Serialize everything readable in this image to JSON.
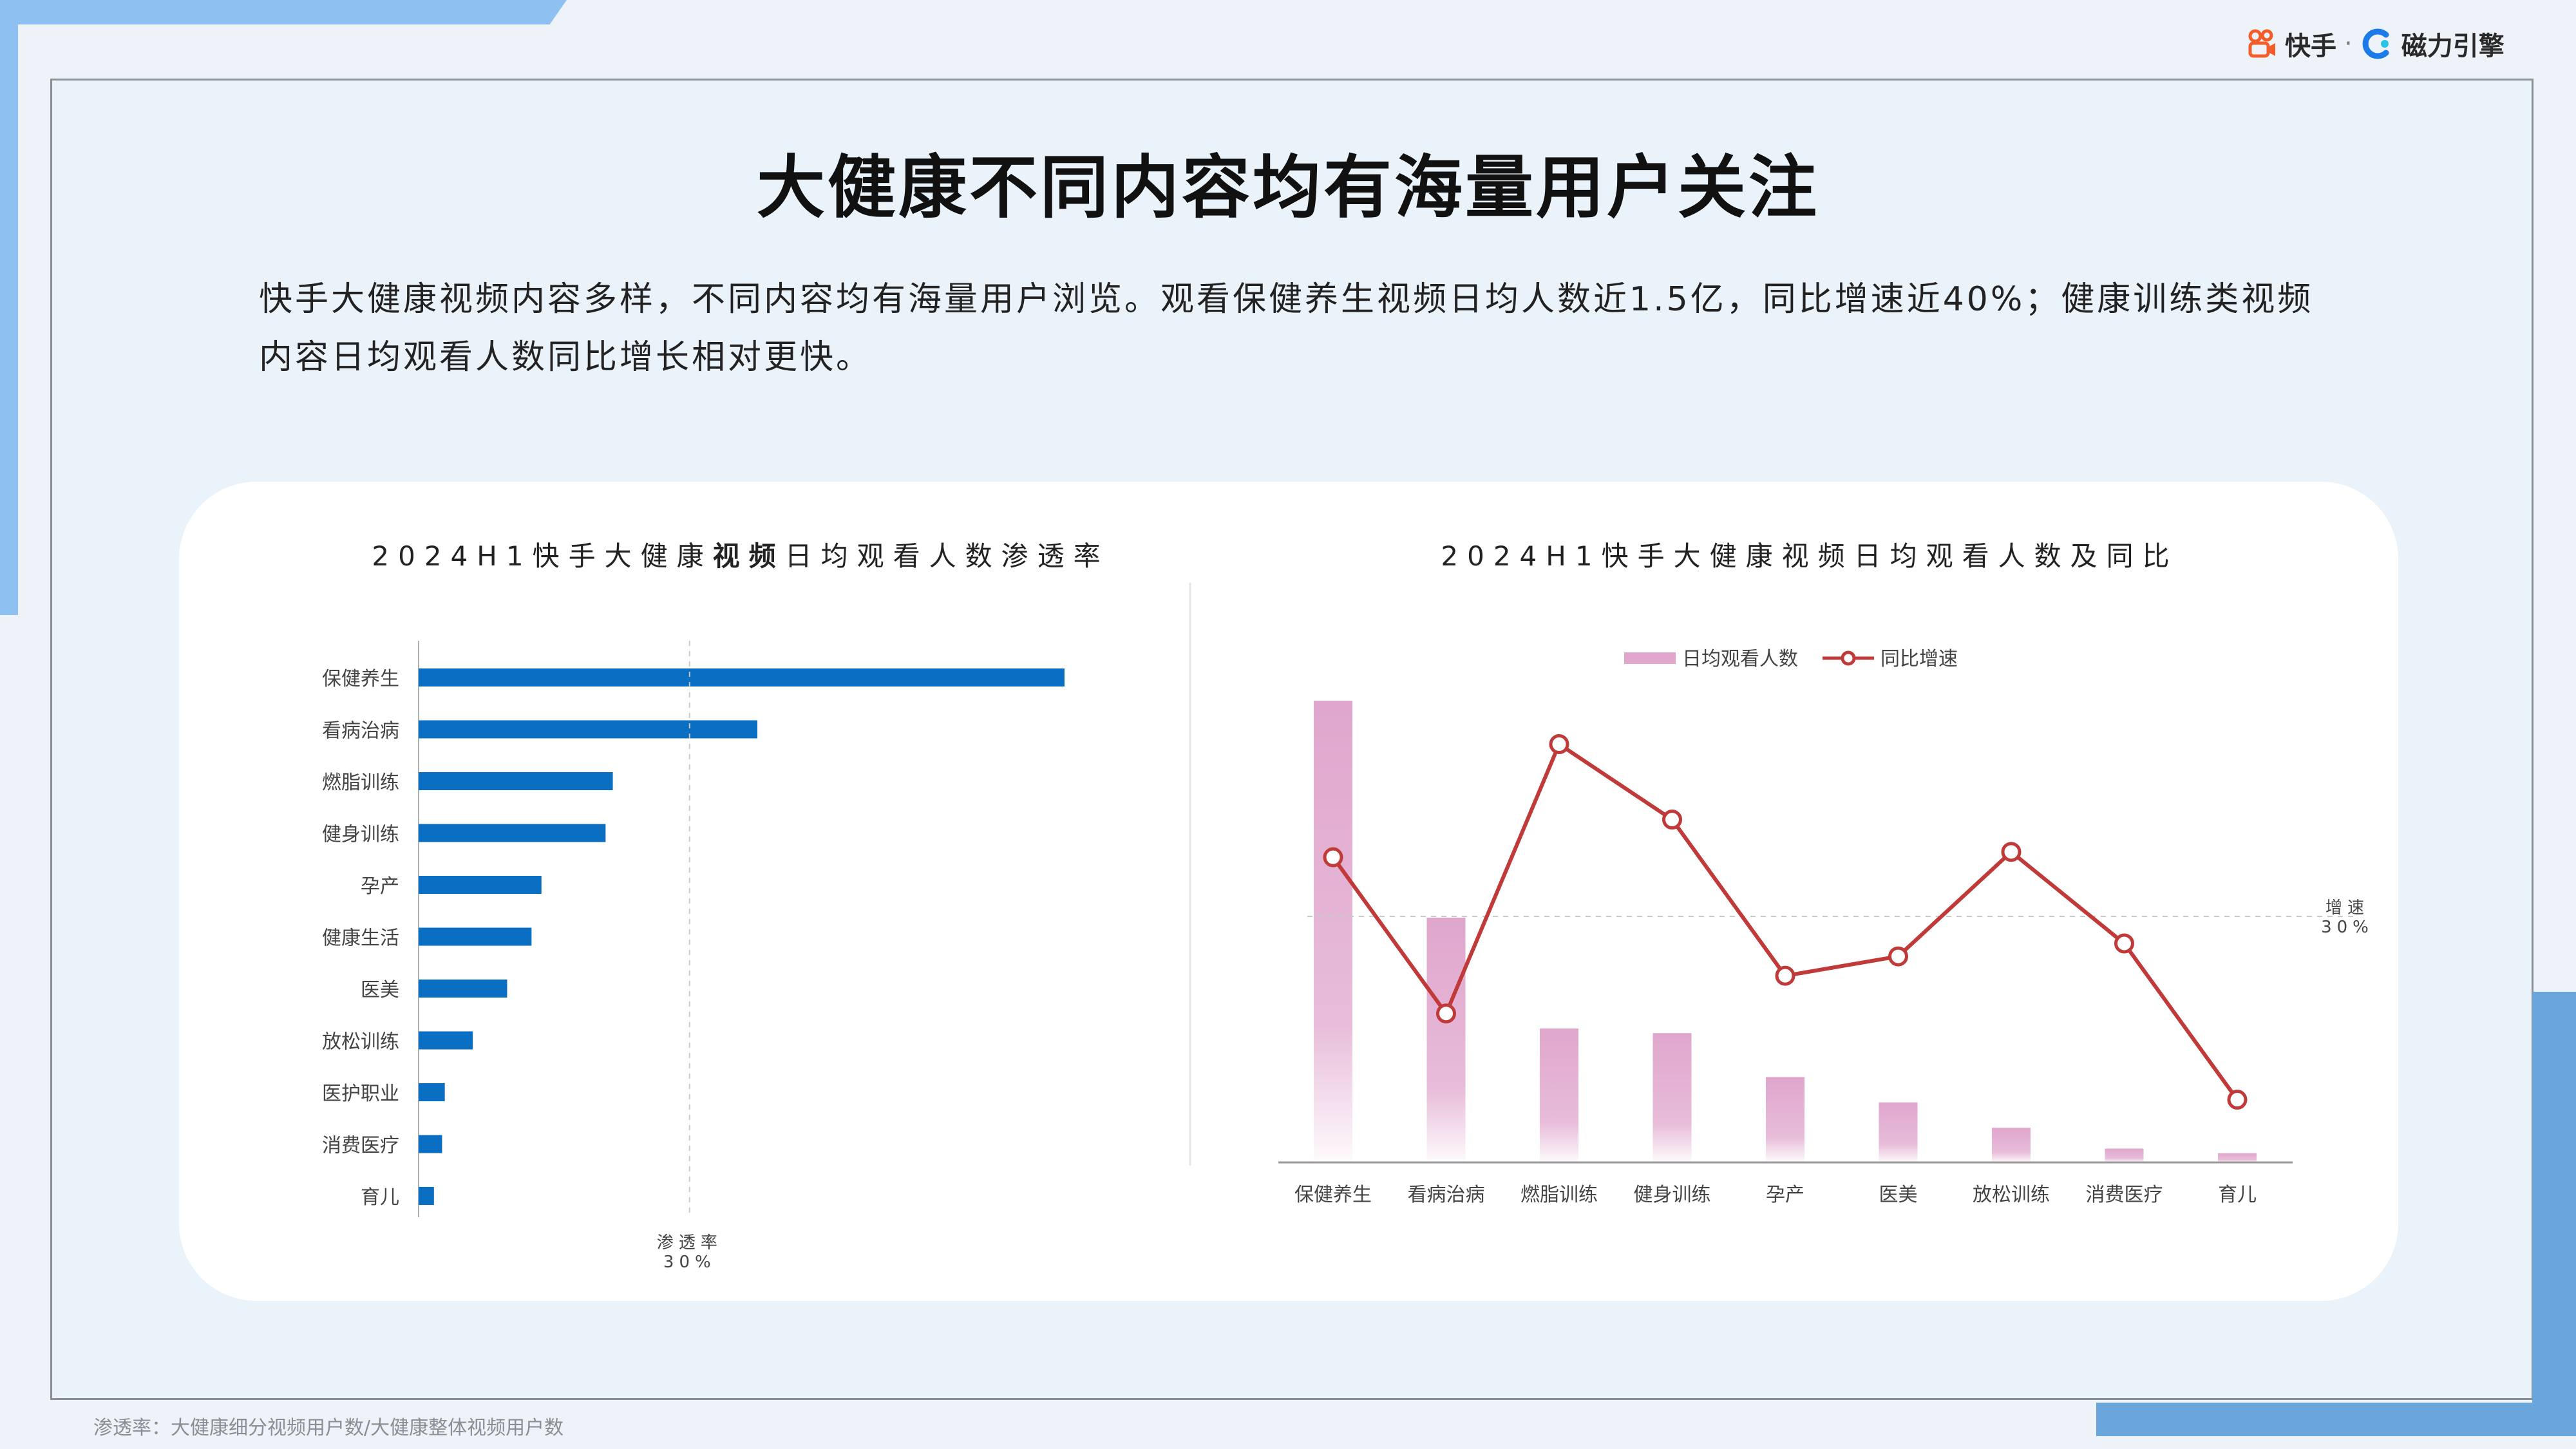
{
  "header": {
    "brand_kuaishou": "快手",
    "brand_separator": "·",
    "brand_cili": "磁力引擎",
    "title": "大健康不同内容均有海量用户关注",
    "description": "快手大健康视频内容多样，不同内容均有海量用户浏览。观看保健养生视频日均人数近1.5亿，同比增速近40%；健康训练类视频内容日均观看人数同比增长相对更快。"
  },
  "footnote": "渗透率：大健康细分视频用户数/大健康整体视频用户数",
  "colors": {
    "bar_blue": "#0a6ec2",
    "bar_pink": "#e0a6cd",
    "line_red": "#c03a3a",
    "ref_line": "#c8c8c8"
  },
  "chart_data": [
    {
      "type": "bar",
      "orientation": "horizontal",
      "title_parts": [
        "2024H1快手大健康",
        "视频",
        "日均观看人数渗透率"
      ],
      "categories": [
        "保健养生",
        "看病治病",
        "燃脂训练",
        "健身训练",
        "孕产",
        "健康生活",
        "医美",
        "放松训练",
        "医护职业",
        "消费医疗",
        "育儿"
      ],
      "values": [
        71.5,
        37.5,
        21.5,
        20.7,
        13.6,
        12.5,
        9.8,
        6.0,
        2.9,
        2.6,
        1.7
      ],
      "xlim": [
        0,
        73
      ],
      "reference_line": {
        "value": 30,
        "label_line1": "渗透率",
        "label_line2": "30%"
      },
      "grid": false
    },
    {
      "type": "bar+line",
      "title": "2024H1快手大健康视频日均观看人数及同比",
      "categories": [
        "保健养生",
        "看病治病",
        "燃脂训练",
        "健身训练",
        "孕产",
        "医美",
        "放松训练",
        "消费医疗",
        "育儿"
      ],
      "series": [
        {
          "name": "日均观看人数",
          "kind": "bar",
          "values": [
            100,
            53,
            29,
            28,
            18.5,
            13,
            7.5,
            3,
            2
          ]
        },
        {
          "name": "同比增速",
          "kind": "line",
          "values": [
            35.5,
            21,
            46,
            39,
            24.5,
            26.3,
            36,
            27.5,
            13
          ]
        }
      ],
      "bar_ylim": [
        0,
        100
      ],
      "line_ylim": [
        0,
        55
      ],
      "reference_line": {
        "value": 30,
        "label_line1": "增速",
        "label_line2": "30%"
      },
      "legend_position": "top",
      "grid": false
    }
  ]
}
